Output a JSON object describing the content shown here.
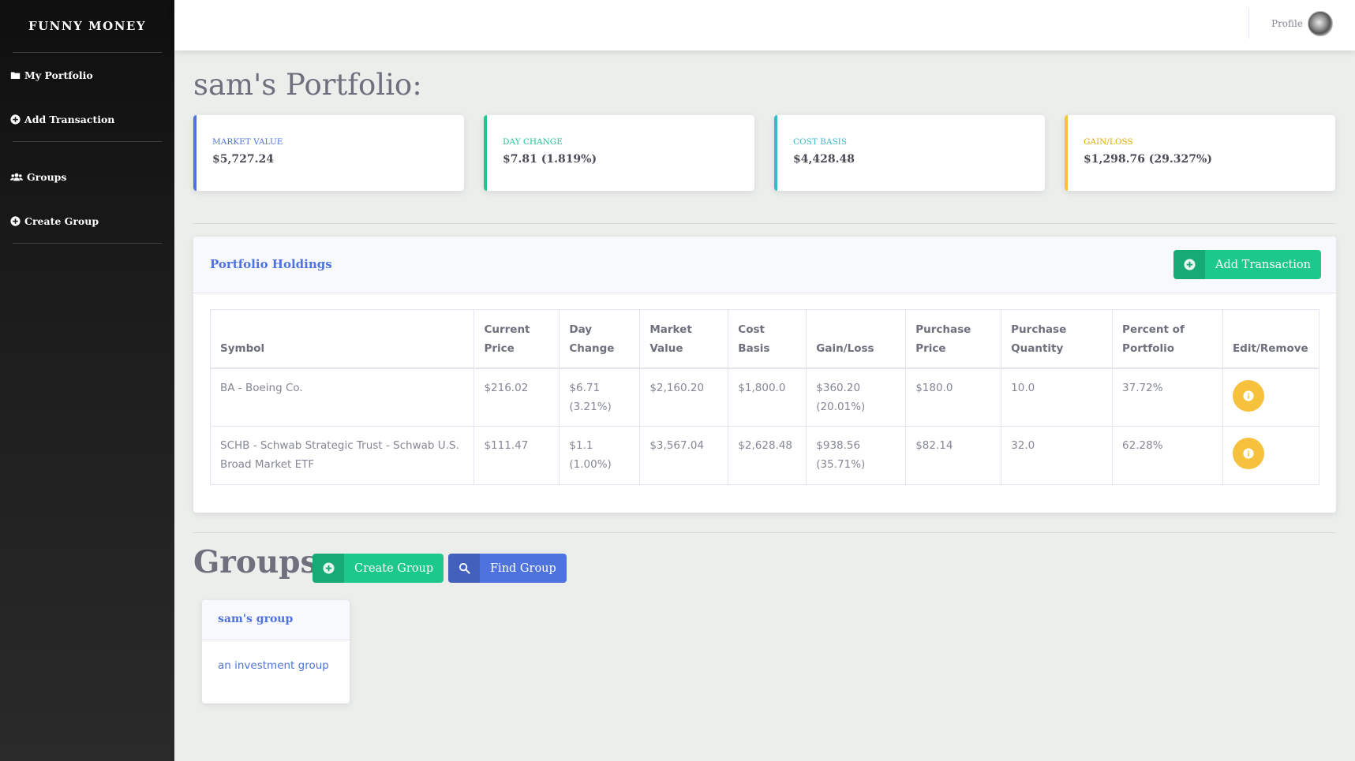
{
  "brand": "FUNNY MONEY",
  "sidebar": {
    "items": [
      {
        "label": "My Portfolio",
        "icon": "folder-icon"
      },
      {
        "label": "Add Transaction",
        "icon": "plus-circle-icon"
      },
      {
        "label": "Groups",
        "icon": "users-icon"
      },
      {
        "label": "Create Group",
        "icon": "plus-circle-icon"
      }
    ]
  },
  "topbar": {
    "profile_label": "Profile"
  },
  "page_title": "sam's Portfolio:",
  "cards": [
    {
      "label": "MARKET VALUE",
      "value": "$5,727.24",
      "color": "#4e73df"
    },
    {
      "label": "DAY CHANGE",
      "value": "$7.81 (1.819%)",
      "color": "#1cc88a"
    },
    {
      "label": "COST BASIS",
      "value": "$4,428.48",
      "color": "#36b9cc"
    },
    {
      "label": "GAIN/LOSS",
      "value": "$1,298.76 (29.327%)",
      "color": "#f6c23e"
    }
  ],
  "holdings": {
    "title": "Portfolio Holdings",
    "add_button": "Add Transaction",
    "columns": [
      "Symbol",
      "Current Price",
      "Day Change",
      "Market Value",
      "Cost Basis",
      "Gain/Loss",
      "Purchase Price",
      "Purchase Quantity",
      "Percent of Portfolio",
      "Edit/Remove"
    ],
    "rows": [
      {
        "symbol": "BA - Boeing Co.",
        "current_price": "$216.02",
        "day_change": "$6.71 (3.21%)",
        "market_value": "$2,160.20",
        "cost_basis": "$1,800.0",
        "gain_loss": "$360.20 (20.01%)",
        "purchase_price": "$180.0",
        "purchase_quantity": "10.0",
        "percent": "37.72%"
      },
      {
        "symbol": "SCHB - Schwab Strategic Trust - Schwab U.S. Broad Market ETF",
        "current_price": "$111.47",
        "day_change": "$1.1 (1.00%)",
        "market_value": "$3,567.04",
        "cost_basis": "$2,628.48",
        "gain_loss": "$938.56 (35.71%)",
        "purchase_price": "$82.14",
        "purchase_quantity": "32.0",
        "percent": "62.28%"
      }
    ]
  },
  "groups": {
    "title": "Groups:",
    "create_button": "Create Group",
    "find_button": "Find Group",
    "list": [
      {
        "name": "sam's group",
        "description": "an investment group"
      }
    ]
  }
}
